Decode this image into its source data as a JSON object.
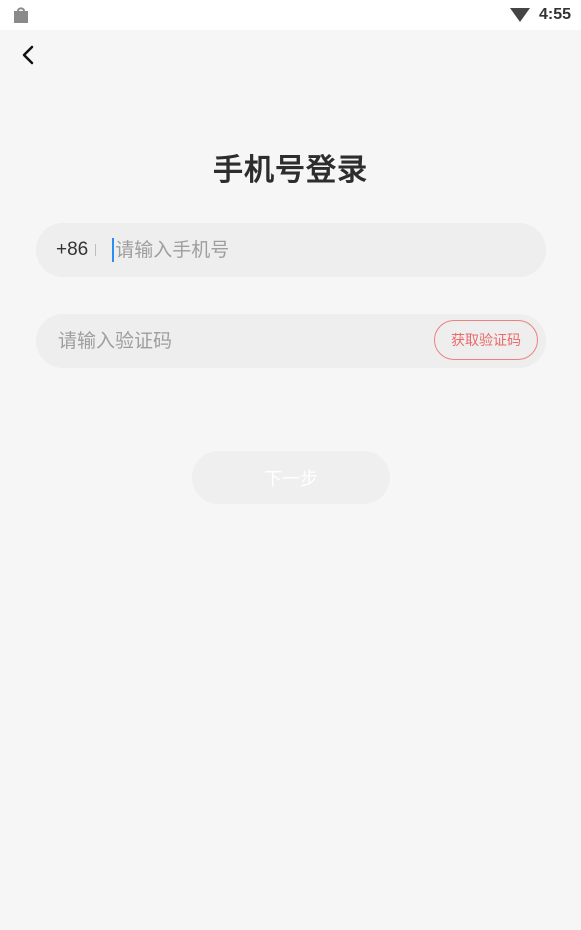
{
  "status_bar": {
    "time": "4:55",
    "left_icon": "shopping-bag-icon",
    "right_icon": "wifi-icon"
  },
  "header": {
    "back_icon": "chevron-left-icon"
  },
  "main": {
    "title": "手机号登录",
    "phone": {
      "country_code": "+86",
      "placeholder": "请输入手机号",
      "value": ""
    },
    "verification": {
      "placeholder": "请输入验证码",
      "value": "",
      "get_code_label": "获取验证码"
    },
    "next_label": "下一步"
  },
  "colors": {
    "background": "#f6f6f6",
    "field_bg": "#eeeeee",
    "accent": "#ea6a6a",
    "caret": "#2a8ff0"
  }
}
